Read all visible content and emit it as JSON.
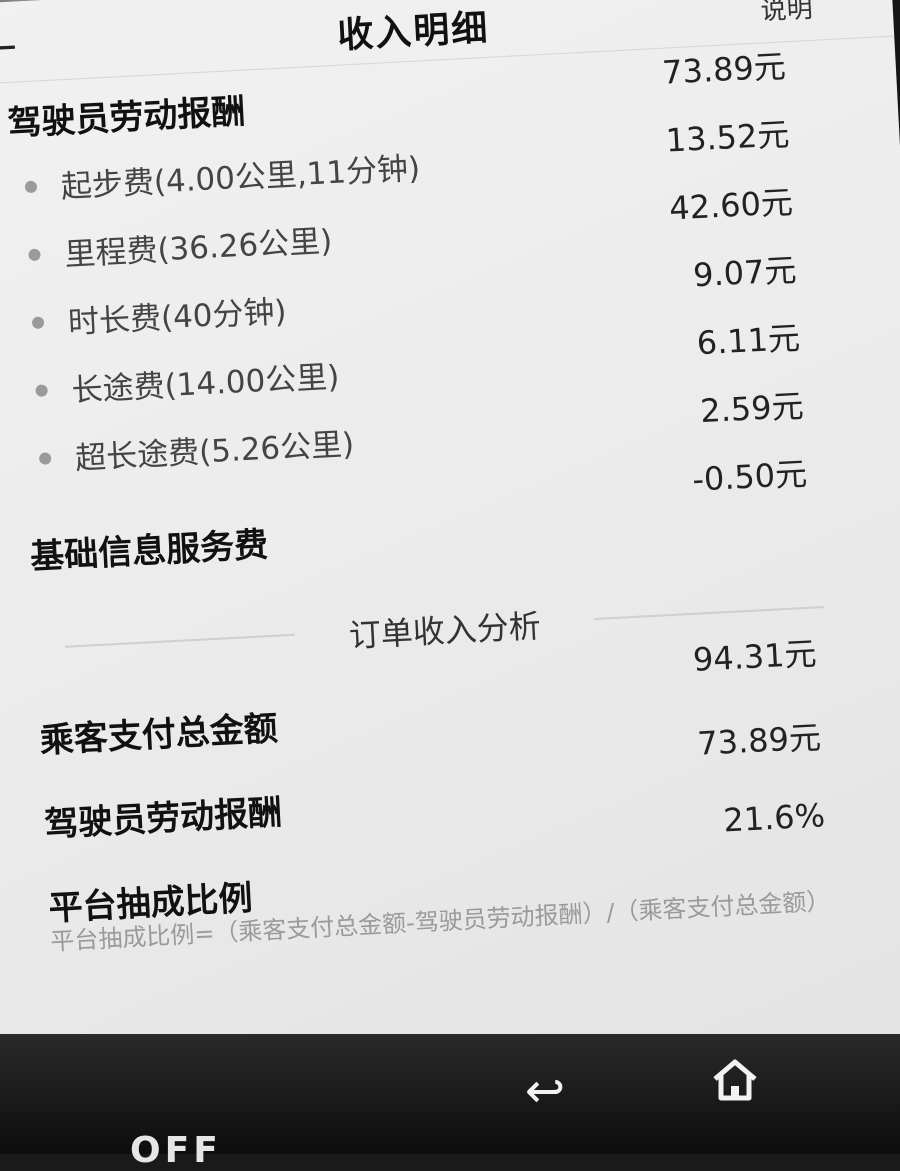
{
  "header": {
    "back_icon": "back-arrow-icon",
    "title": "收入明细",
    "help": "说明"
  },
  "income": {
    "driver_pay": {
      "label": "驾驶员劳动报酬",
      "amount": "73.89元"
    },
    "items": [
      {
        "label": "起步费(4.00公里,11分钟)",
        "amount": "13.52元"
      },
      {
        "label": "里程费(36.26公里)",
        "amount": "42.60元"
      },
      {
        "label": "时长费(40分钟)",
        "amount": "9.07元"
      },
      {
        "label": "长途费(14.00公里)",
        "amount": "6.11元"
      },
      {
        "label": "超长途费(5.26公里)",
        "amount": "2.59元"
      }
    ],
    "service_fee": {
      "label": "基础信息服务费",
      "amount": "-0.50元"
    }
  },
  "analysis": {
    "title": "订单收入分析",
    "passenger_total": {
      "label": "乘客支付总金额",
      "amount": "94.31元"
    },
    "driver_pay": {
      "label": "驾驶员劳动报酬",
      "amount": "73.89元"
    },
    "commission": {
      "label": "平台抽成比例",
      "amount": "21.6%"
    },
    "formula": "平台抽成比例=（乘客支付总金额-驾驶员劳动报酬）/（乘客支付总金额）"
  },
  "navbar": {
    "back_icon": "back-icon",
    "home_icon": "home-icon",
    "brand": "OFF"
  }
}
